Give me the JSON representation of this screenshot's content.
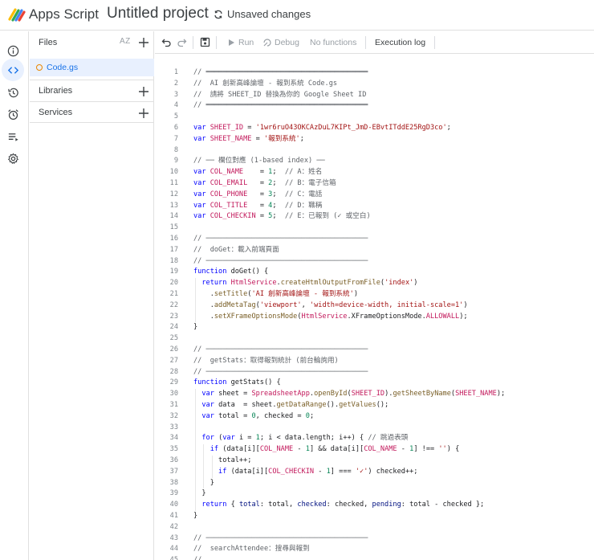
{
  "header": {
    "app_name": "Apps Script",
    "project_title": "Untitled project",
    "save_status": "Unsaved changes"
  },
  "rail": {
    "items": [
      "info-icon",
      "editor-icon",
      "history-icon",
      "triggers-icon",
      "executions-icon",
      "settings-icon"
    ],
    "active": "editor-icon"
  },
  "files_panel": {
    "title": "Files",
    "sort_label": "AZ",
    "files": [
      {
        "name": "Code.gs",
        "active": true
      }
    ],
    "libraries_label": "Libraries",
    "services_label": "Services"
  },
  "toolbar": {
    "run_label": "Run",
    "debug_label": "Debug",
    "function_select": "No functions",
    "execution_log_label": "Execution log"
  },
  "editor": {
    "lines": [
      {
        "n": "1",
        "t": "// ═══════════════════════════════════════",
        "k": "cm"
      },
      {
        "n": "2",
        "t": "//  AI 創新高峰論壇 - 報到系統 Code.gs",
        "k": "cm"
      },
      {
        "n": "3",
        "t": "//  請將 SHEET_ID 替換為你的 Google Sheet ID",
        "k": "cm"
      },
      {
        "n": "4",
        "t": "// ═══════════════════════════════════════",
        "k": "cm"
      },
      {
        "n": "5",
        "t": "",
        "k": ""
      },
      {
        "n": "6",
        "t": "var SHEET_ID = '1wr6ruO43OKCAzDuL7KIPt_JmD-EBvtITddE25RgD3co';",
        "k": "decl"
      },
      {
        "n": "7",
        "t": "var SHEET_NAME = '報到系統';",
        "k": "decl"
      },
      {
        "n": "8",
        "t": "",
        "k": ""
      },
      {
        "n": "9",
        "t": "// ── 欄位對應 (1-based index) ──",
        "k": "cm"
      },
      {
        "n": "10",
        "t": "var COL_NAME    = 1;  // A：姓名",
        "k": "col"
      },
      {
        "n": "11",
        "t": "var COL_EMAIL   = 2;  // B：電子信箱",
        "k": "col"
      },
      {
        "n": "12",
        "t": "var COL_PHONE   = 3;  // C：電話",
        "k": "col"
      },
      {
        "n": "13",
        "t": "var COL_TITLE   = 4;  // D：職稱",
        "k": "col"
      },
      {
        "n": "14",
        "t": "var COL_CHECKIN = 5;  // E：已報到 (✓ 或空白)",
        "k": "col"
      },
      {
        "n": "15",
        "t": "",
        "k": ""
      },
      {
        "n": "16",
        "t": "// ───────────────────────────────────────",
        "k": "cm"
      },
      {
        "n": "17",
        "t": "//  doGet：載入前端頁面",
        "k": "cm"
      },
      {
        "n": "18",
        "t": "// ───────────────────────────────────────",
        "k": "cm"
      },
      {
        "n": "19",
        "t": "function doGet() {",
        "k": "fn"
      },
      {
        "n": "20",
        "t": "  return HtmlService.createHtmlOutputFromFile('index')",
        "k": "code"
      },
      {
        "n": "21",
        "t": "    .setTitle('AI 創新高峰論壇 - 報到系統')",
        "k": "code"
      },
      {
        "n": "22",
        "t": "    .addMetaTag('viewport', 'width=device-width, initial-scale=1')",
        "k": "code"
      },
      {
        "n": "23",
        "t": "    .setXFrameOptionsMode(HtmlService.XFrameOptionsMode.ALLOWALL);",
        "k": "code"
      },
      {
        "n": "24",
        "t": "}",
        "k": "code"
      },
      {
        "n": "25",
        "t": "",
        "k": ""
      },
      {
        "n": "26",
        "t": "// ───────────────────────────────────────",
        "k": "cm"
      },
      {
        "n": "27",
        "t": "//  getStats：取得報到統計 (前台輪詢用)",
        "k": "cm"
      },
      {
        "n": "28",
        "t": "// ───────────────────────────────────────",
        "k": "cm"
      },
      {
        "n": "29",
        "t": "function getStats() {",
        "k": "fn"
      },
      {
        "n": "30",
        "t": "  var sheet = SpreadsheetApp.openById(SHEET_ID).getSheetByName(SHEET_NAME);",
        "k": "code"
      },
      {
        "n": "31",
        "t": "  var data  = sheet.getDataRange().getValues();",
        "k": "code"
      },
      {
        "n": "32",
        "t": "  var total = 0, checked = 0;",
        "k": "code"
      },
      {
        "n": "33",
        "t": "",
        "k": ""
      },
      {
        "n": "34",
        "t": "  for (var i = 1; i < data.length; i++) { // 跳過表頭",
        "k": "code"
      },
      {
        "n": "35",
        "t": "    if (data[i][COL_NAME - 1] && data[i][COL_NAME - 1] !== '') {",
        "k": "code"
      },
      {
        "n": "36",
        "t": "      total++;",
        "k": "code"
      },
      {
        "n": "37",
        "t": "      if (data[i][COL_CHECKIN - 1] === '✓') checked++;",
        "k": "code"
      },
      {
        "n": "38",
        "t": "    }",
        "k": "code"
      },
      {
        "n": "39",
        "t": "  }",
        "k": "code"
      },
      {
        "n": "40",
        "t": "  return { total: total, checked: checked, pending: total - checked };",
        "k": "code"
      },
      {
        "n": "41",
        "t": "}",
        "k": "code"
      },
      {
        "n": "42",
        "t": "",
        "k": ""
      },
      {
        "n": "43",
        "t": "// ───────────────────────────────────────",
        "k": "cm"
      },
      {
        "n": "44",
        "t": "//  searchAttendee：搜尋與報到",
        "k": "cm"
      },
      {
        "n": "45",
        "t": "//  ...",
        "k": "cm"
      }
    ]
  },
  "colors": {
    "accent": "#1a73e8",
    "keyword": "#0000ff",
    "string": "#a31515",
    "comment": "#5f6368",
    "constant": "#c2185b",
    "number": "#098658"
  }
}
